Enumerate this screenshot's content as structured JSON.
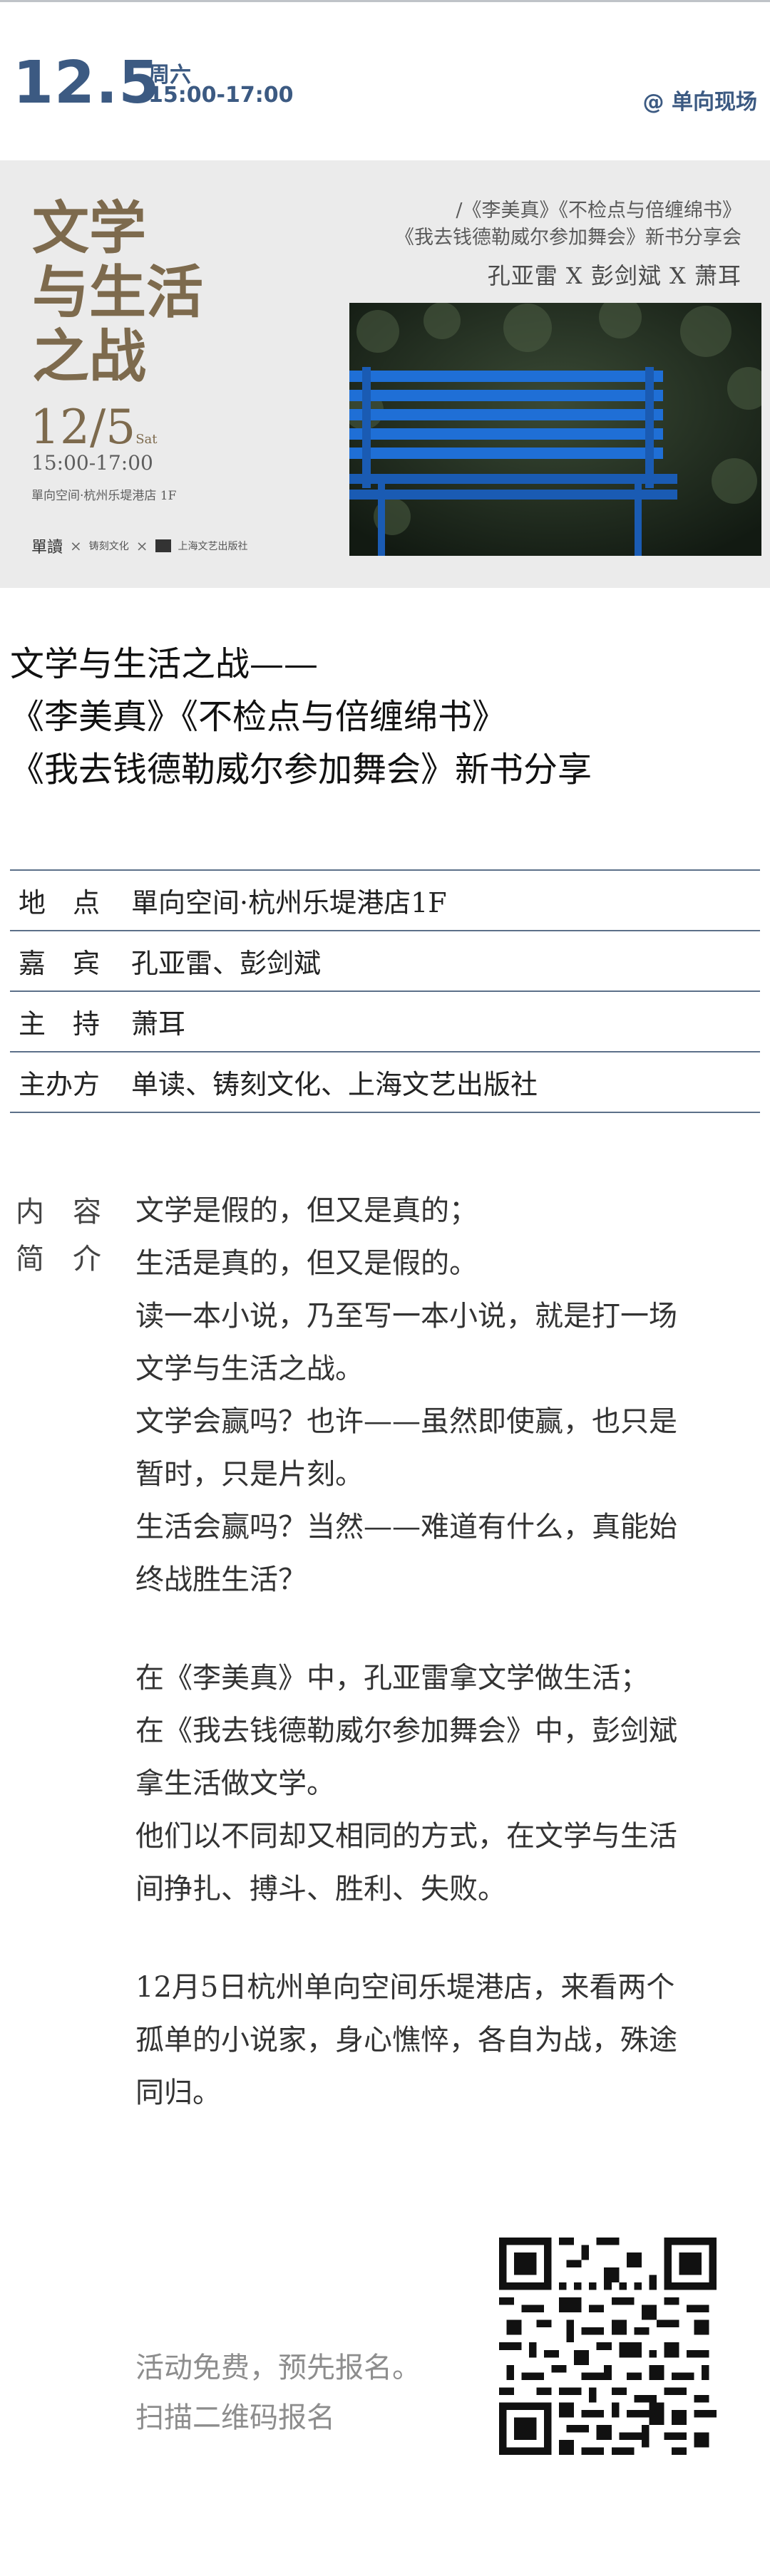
{
  "header": {
    "date": "12.5",
    "weekday": "周六",
    "time": "15:00-17:00",
    "brand": "@ 单向现场",
    "accent_color": "#3c5a82"
  },
  "poster": {
    "title_lines": [
      "文学",
      "与生活",
      "之战"
    ],
    "date": "12/5",
    "date_suffix": "Sat",
    "time": "15:00-17:00",
    "place": "單向空间·杭州乐堤港店 1F",
    "books_line1": "/《李美真》《不检点与倍缠绵书》",
    "books_line2": "《我去钱德勒威尔参加舞会》新书分享会",
    "authors": "孔亚雷 X 彭剑斌 X 萧耳",
    "logo_dandu": "單讀",
    "logo_zhuke": "铸刻文化",
    "logo_x": "×",
    "logo_shanghai": "上海文艺出版社"
  },
  "event": {
    "title_lines": [
      "文学与生活之战——",
      "《李美真》《不检点与倍缠绵书》",
      "《我去钱德勒威尔参加舞会》新书分享"
    ]
  },
  "info": {
    "rows": [
      {
        "label": "地　点",
        "value": "單向空间·杭州乐堤港店1F"
      },
      {
        "label": "嘉　宾",
        "value": "孔亚雷、彭剑斌"
      },
      {
        "label": "主　持",
        "value": "萧耳"
      },
      {
        "label": "主办方",
        "value": "单读、铸刻文化、上海文艺出版社"
      }
    ]
  },
  "intro": {
    "label_line1": "内　容",
    "label_line2": "简　介",
    "para1": [
      "文学是假的，但又是真的；",
      "生活是真的，但又是假的。",
      "读一本小说，乃至写一本小说，就是打一场",
      "文学与生活之战。",
      "文学会赢吗？也许——虽然即使赢，也只是",
      "暂时，只是片刻。",
      "生活会赢吗？当然——难道有什么，真能始",
      "终战胜生活？"
    ],
    "para2": [
      "在《李美真》中，孔亚雷拿文学做生活；",
      "在《我去钱德勒威尔参加舞会》中，彭剑斌",
      "拿生活做文学。",
      "他们以不同却又相同的方式，在文学与生活",
      "间挣扎、搏斗、胜利、失败。"
    ],
    "para3": [
      "12月5日杭州单向空间乐堤港店，来看两个",
      "孤单的小说家，身心憔悴，各自为战，殊途",
      "同归。"
    ]
  },
  "footer": {
    "line1": "活动免费，预先报名。",
    "line2": "扫描二维码报名"
  }
}
